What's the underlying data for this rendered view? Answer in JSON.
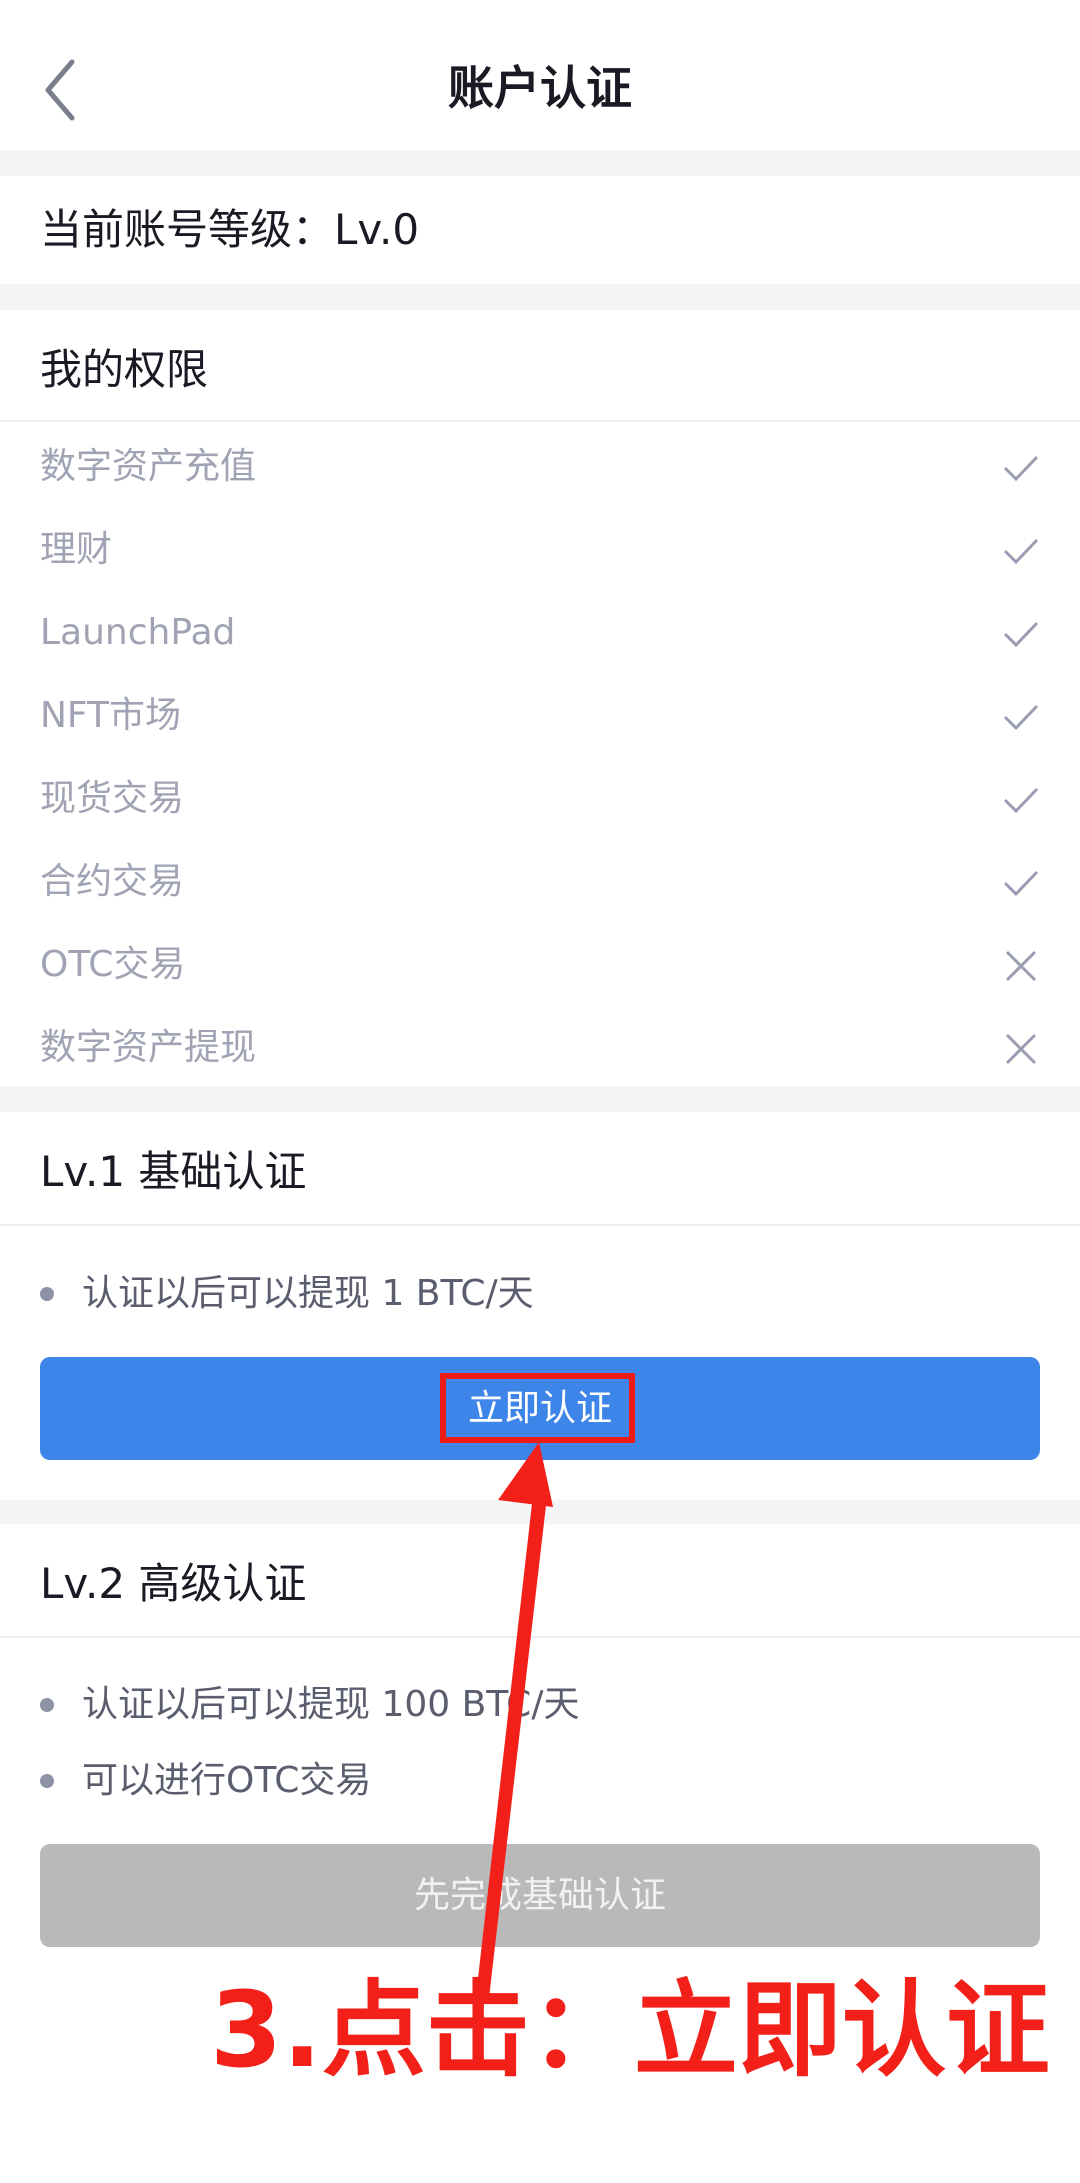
{
  "header": {
    "title": "账户认证"
  },
  "account_level": {
    "label": "当前账号等级：Lv.0"
  },
  "permissions": {
    "title": "我的权限",
    "items": [
      {
        "label": "数字资产充值",
        "granted": true
      },
      {
        "label": "理财",
        "granted": true
      },
      {
        "label": "LaunchPad",
        "granted": true
      },
      {
        "label": "NFT市场",
        "granted": true
      },
      {
        "label": "现货交易",
        "granted": true
      },
      {
        "label": "合约交易",
        "granted": true
      },
      {
        "label": "OTC交易",
        "granted": false
      },
      {
        "label": "数字资产提现",
        "granted": false
      }
    ]
  },
  "lv1": {
    "title": "Lv.1  基础认证",
    "bullets": [
      "认证以后可以提现  1  BTC/天"
    ],
    "button_label": "立即认证"
  },
  "lv2": {
    "title": "Lv.2  高级认证",
    "bullets": [
      "认证以后可以提现  100  BTC/天",
      "可以进行OTC交易"
    ],
    "button_label": "先完成基础认证"
  },
  "annotation": {
    "text": "3.点击：立即认证"
  },
  "colors": {
    "primary": "#3d85e9",
    "annotation": "#f3201a"
  }
}
